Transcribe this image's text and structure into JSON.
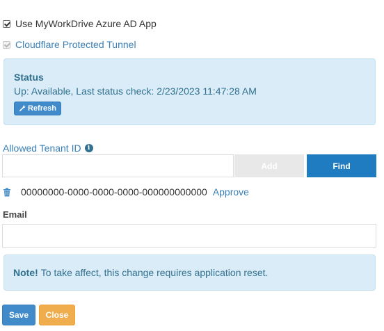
{
  "settings": {
    "use_azure_app": {
      "label": "Use MyWorkDrive Azure AD App",
      "checked": true
    },
    "cloudflare_tunnel": {
      "label": "Cloudflare Protected Tunnel",
      "checked": true,
      "disabled": true
    }
  },
  "status": {
    "title": "Status",
    "text": "Up: Available, Last status check: 2/23/2023 11:47:28 AM",
    "refresh_label": "Refresh"
  },
  "tenant": {
    "label": "Allowed Tenant ID",
    "input_value": "",
    "add_label": "Add",
    "find_label": "Find",
    "entries": [
      {
        "id": "00000000-0000-0000-0000-000000000000",
        "action_label": "Approve"
      }
    ]
  },
  "email": {
    "label": "Email",
    "value": ""
  },
  "note": {
    "strong": "Note!",
    "text": "To take affect, this change requires application reset."
  },
  "footer": {
    "save_label": "Save",
    "close_label": "Close"
  },
  "colors": {
    "primary": "#428bca",
    "find_button": "#1f7cc1",
    "warning": "#f0ad4e",
    "info_panel": "#d9ecf7",
    "info_text": "#31708f",
    "link": "#3a7fb5"
  }
}
